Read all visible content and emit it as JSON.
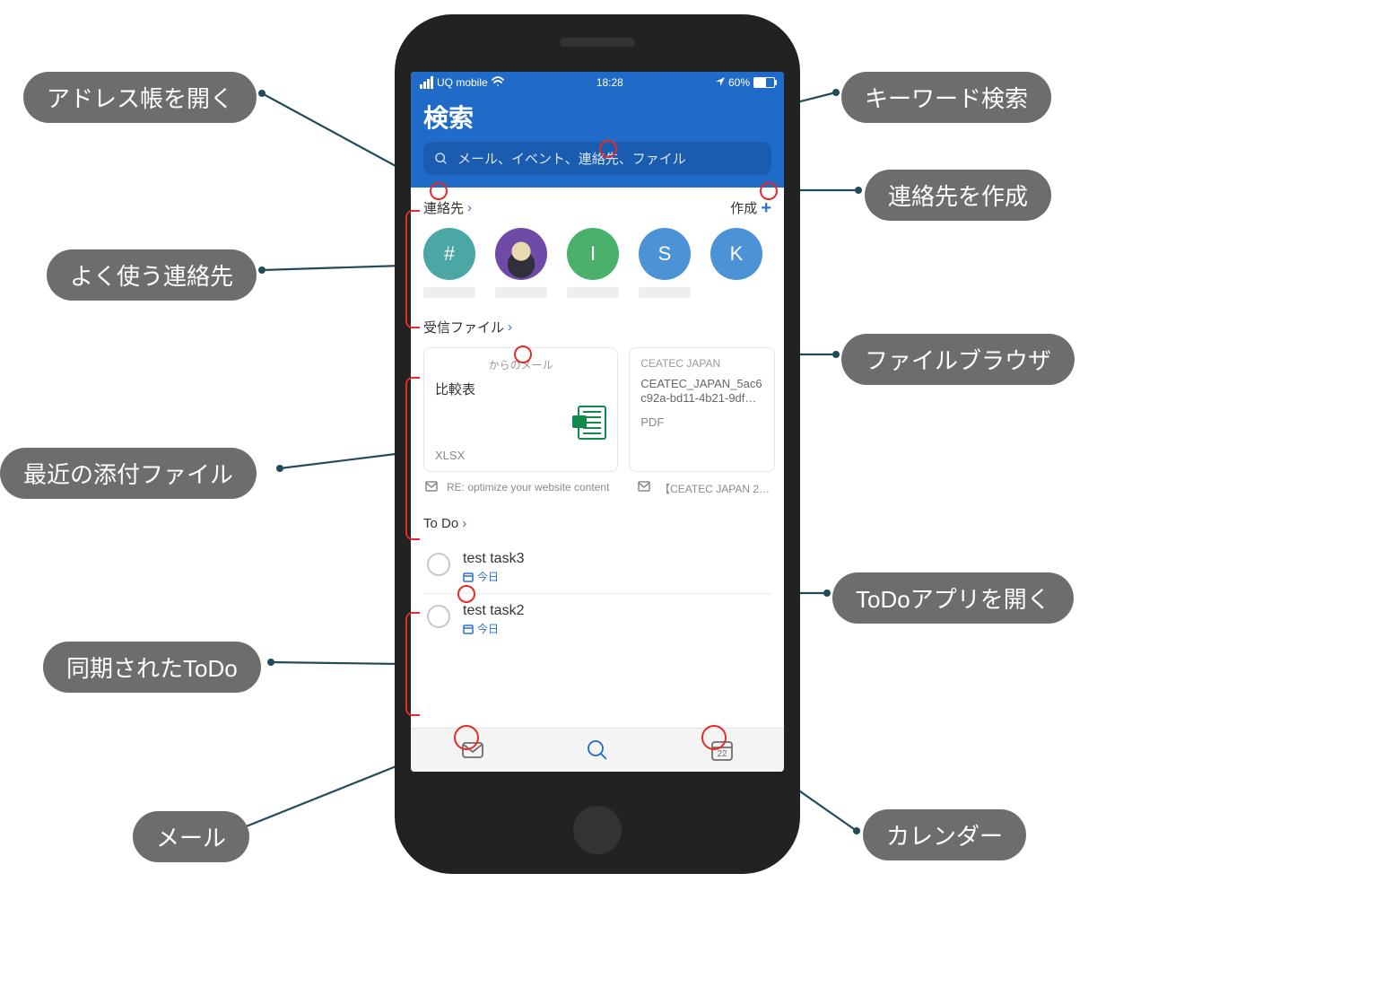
{
  "statusbar": {
    "carrier": "UQ mobile",
    "time": "18:28",
    "battery_pct": "60%"
  },
  "header": {
    "title": "検索"
  },
  "search": {
    "placeholder": "メール、イベント、連絡先、ファイル"
  },
  "contacts_section": {
    "label": "連絡先",
    "create_label": "作成",
    "items": [
      {
        "letter": "#",
        "color": "#4aa7a3"
      },
      {
        "letter": "",
        "color": "#6d4ba7",
        "is_image": true
      },
      {
        "letter": "I",
        "color": "#4bb06b"
      },
      {
        "letter": "S",
        "color": "#4c93d6"
      },
      {
        "letter": "K",
        "color": "#4c93d6"
      }
    ]
  },
  "files_section": {
    "label": "受信ファイル",
    "cards": [
      {
        "from": "からのメール",
        "title": "比較表",
        "type": "XLSX",
        "mail_subject": "RE: optimize your website content"
      },
      {
        "from": "CEATEC JAPAN",
        "body": "CEATEC_JAPAN_5ac6c92a-bd11-4b21-9df…",
        "type": "PDF",
        "mail_subject": "【CEATEC JAPAN 2…"
      }
    ]
  },
  "todo_section": {
    "label": "To Do",
    "items": [
      {
        "title": "test task3",
        "due": "今日"
      },
      {
        "title": "test task2",
        "due": "今日"
      }
    ]
  },
  "tabbar": {
    "calendar_day": "22"
  },
  "callouts": {
    "addr_book": "アドレス帳を開く",
    "freq_contacts": "よく使う連絡先",
    "recent_attach": "最近の添付ファイル",
    "synced_todo": "同期されたToDo",
    "mail": "メール",
    "keyword_search": "キーワード検索",
    "create_contact": "連絡先を作成",
    "file_browser": "ファイルブラウザ",
    "open_todo": "ToDoアプリを開く",
    "calendar": "カレンダー"
  }
}
